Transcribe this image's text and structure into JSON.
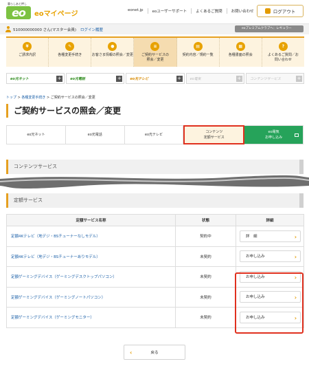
{
  "header": {
    "logo_tagline": "暮らしあと押し",
    "logo_text": "eo",
    "app_name": "eoマイページ",
    "links": [
      "eonet.jp",
      "eoユーザーサポート",
      "よくあるご質問",
      "お問い合わせ"
    ],
    "login_label": "ログアウト"
  },
  "user_bar": {
    "user_text": "510000000000 さん(マスター会員)",
    "login_history": "ログイン履歴",
    "premium_badge": "eoプレミアムクラブへ：レギュラー"
  },
  "main_menu": [
    {
      "icon": "yen-icon",
      "glyph": "¥",
      "label": "ご請求内訳"
    },
    {
      "icon": "edit-icon",
      "glyph": "✎",
      "label": "各種変更手続き"
    },
    {
      "icon": "person-icon",
      "glyph": "●",
      "label": "お客さま情報の照会／変更"
    },
    {
      "icon": "list-icon",
      "glyph": "≡",
      "label": "ご契約サービスの\n照会／変更"
    },
    {
      "icon": "contract-icon",
      "glyph": "▤",
      "label": "契約内容／規約一覧"
    },
    {
      "icon": "document-icon",
      "glyph": "▦",
      "label": "各種書面の照会"
    },
    {
      "icon": "question-icon",
      "glyph": "?",
      "label": "よくあるご質問／お\n問い合わせ"
    }
  ],
  "service_tabs": [
    {
      "label": "eo光ネット",
      "disabled": false,
      "style": "g"
    },
    {
      "label": "eo光電話",
      "disabled": false,
      "style": "g"
    },
    {
      "label": "eo光テレビ",
      "disabled": false,
      "style": "o"
    },
    {
      "label": "eo電気",
      "disabled": true,
      "style": "x"
    },
    {
      "label": "コンテンツサービス",
      "disabled": true,
      "style": "x"
    }
  ],
  "breadcrumb": {
    "items": [
      "トップ",
      "各種変更手続き",
      "ご契約サービスの照会／変更"
    ]
  },
  "page_title": "ご契約サービスの照会／変更",
  "category_tabs": [
    {
      "label": "eo光ネット"
    },
    {
      "label": "eo光電話"
    },
    {
      "label": "eo光テレビ"
    },
    {
      "label": "コンテンツ\n定額サービス"
    },
    {
      "label": "eo電気\nお申し込み"
    }
  ],
  "sections": {
    "content": "コンテンツサービス",
    "fixed": "定額サービス"
  },
  "table": {
    "headers": [
      "定額サービス名称",
      "状態",
      "詳細"
    ],
    "rows": [
      {
        "name": "定額4Kテレビ（地デジ・BSチューナーなしモデル）",
        "status": "契約中",
        "action": "詳　細"
      },
      {
        "name": "定額4Kテレビ（地デジ・BSチューナーありモデル）",
        "status": "未契約",
        "action": "お申し込み"
      },
      {
        "name": "定額ゲーミングデバイス（ゲーミングデスクトップパソコン）",
        "status": "未契約",
        "action": "お申し込み"
      },
      {
        "name": "定額ゲーミングデバイス（ゲーミングノートパソコン）",
        "status": "未契約",
        "action": "お申し込み"
      },
      {
        "name": "定額ゲーミングデバイス（ゲーミングモニター）",
        "status": "未契約",
        "action": "お申し込み"
      }
    ]
  },
  "back_label": "戻る",
  "colors": {
    "accent": "#e6a020",
    "brand_green": "#7cc242",
    "link": "#1a5fa8",
    "highlight_red": "#e0301e"
  }
}
